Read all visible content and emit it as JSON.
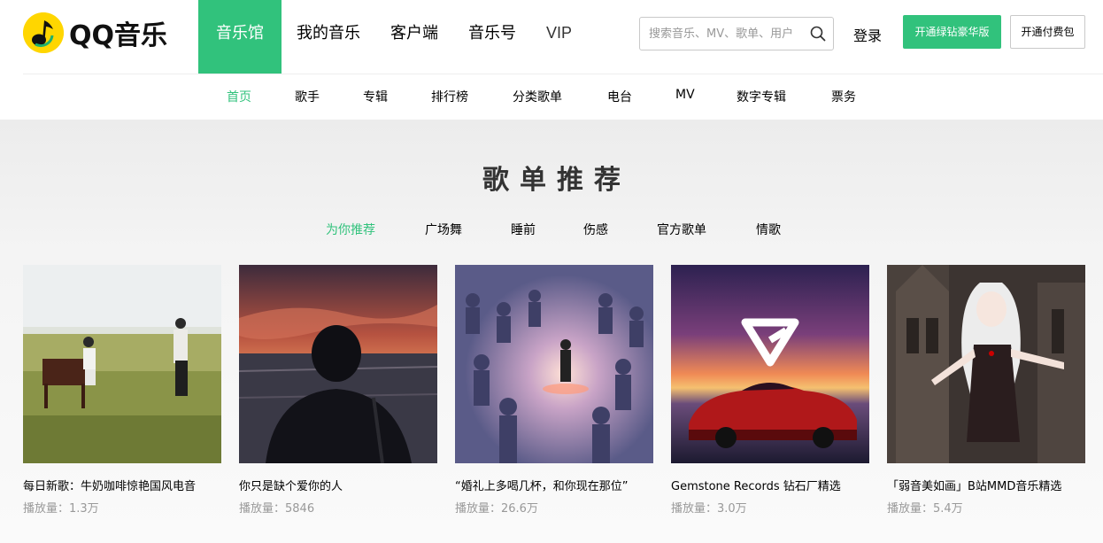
{
  "logo": {
    "text": "QQ音乐"
  },
  "topnav": [
    {
      "label": "音乐馆",
      "active": true
    },
    {
      "label": "我的音乐",
      "active": false
    },
    {
      "label": "客户端",
      "active": false
    },
    {
      "label": "音乐号",
      "active": false
    },
    {
      "label": "VIP",
      "active": false
    }
  ],
  "search": {
    "placeholder": "搜索音乐、MV、歌单、用户",
    "value": ""
  },
  "header_actions": {
    "login": "登录",
    "green_button": "开通绿钻豪华版",
    "outline_button": "开通付费包"
  },
  "subnav": [
    {
      "label": "首页",
      "active": true
    },
    {
      "label": "歌手"
    },
    {
      "label": "专辑"
    },
    {
      "label": "排行榜"
    },
    {
      "label": "分类歌单"
    },
    {
      "label": "电台"
    },
    {
      "label": "MV"
    },
    {
      "label": "数字专辑"
    },
    {
      "label": "票务"
    }
  ],
  "section": {
    "title": "歌单推荐"
  },
  "categories": [
    {
      "label": "为你推荐",
      "active": true
    },
    {
      "label": "广场舞"
    },
    {
      "label": "睡前"
    },
    {
      "label": "伤感"
    },
    {
      "label": "官方歌单"
    },
    {
      "label": "情歌"
    }
  ],
  "playlists": [
    {
      "title": "每日新歌：牛奶咖啡惊艳国风电音",
      "plays": "播放量：1.3万"
    },
    {
      "title": "你只是缺个爱你的人",
      "plays": "播放量：5846"
    },
    {
      "title": "“婚礼上多喝几杯，和你现在那位”",
      "plays": "播放量：26.6万"
    },
    {
      "title": "Gemstone Records 钻石厂精选",
      "plays": "播放量：3.0万"
    },
    {
      "title": "「弱音美如画」B站MMD音乐精选",
      "plays": "播放量：5.4万"
    }
  ],
  "colors": {
    "accent": "#31c27c",
    "logo_yellow": "#ffd600"
  }
}
